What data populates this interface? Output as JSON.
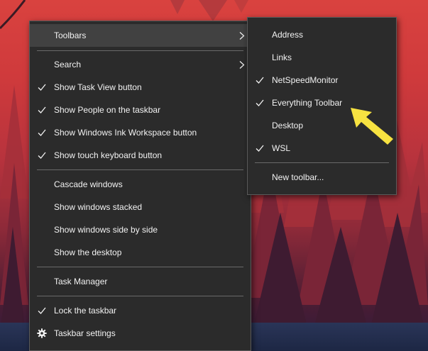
{
  "colors": {
    "menu_bg": "#2b2b2b",
    "menu_text": "#f2f2f2",
    "hover_bg": "#414141",
    "separator": "#6a6a6a",
    "annotation_arrow": "#f7e241"
  },
  "main_menu": {
    "toolbars": "Toolbars",
    "search": "Search",
    "show_task_view": "Show Task View button",
    "show_people": "Show People on the taskbar",
    "show_ink": "Show Windows Ink Workspace button",
    "show_touch_keyboard": "Show touch keyboard button",
    "cascade": "Cascade windows",
    "stacked": "Show windows stacked",
    "side_by_side": "Show windows side by side",
    "show_desktop": "Show the desktop",
    "task_manager": "Task Manager",
    "lock_taskbar": "Lock the taskbar",
    "taskbar_settings": "Taskbar settings"
  },
  "toolbars_submenu": {
    "address": "Address",
    "links": "Links",
    "netspeed": "NetSpeedMonitor",
    "everything": "Everything Toolbar",
    "desktop": "Desktop",
    "wsl": "WSL",
    "new_toolbar": "New toolbar..."
  },
  "icons": {
    "check": "check-icon",
    "submenu_arrow": "chevron-right-icon",
    "settings": "gear-icon",
    "annotation": "yellow-arrow-icon"
  }
}
